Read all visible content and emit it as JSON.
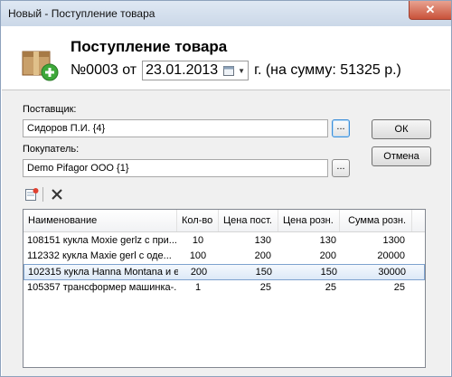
{
  "window": {
    "title": "Новый - Поступление товара"
  },
  "header": {
    "title": "Поступление товара",
    "number_label": "№0003 от",
    "date": "23.01.2013",
    "sum_text": "г. (на сумму: 51325 р.)"
  },
  "form": {
    "supplier_label": "Поставщик:",
    "supplier_value": "Сидоров П.И. {4}",
    "buyer_label": "Покупатель:",
    "buyer_value": "Demo Pifagor ООО {1}",
    "ellipsis": "...",
    "ok_label": "ОК",
    "cancel_label": "Отмена"
  },
  "toolbar": {
    "add_icon": "add-row-icon",
    "delete_icon": "delete-icon"
  },
  "table": {
    "columns": [
      "Наименование",
      "Кол-во",
      "Цена пост.",
      "Цена розн.",
      "Сумма розн."
    ],
    "rows": [
      {
        "name": "108151 кукла Moxie gerlz с при...",
        "qty": "10",
        "price_in": "130",
        "price_retail": "130",
        "sum_retail": "1300"
      },
      {
        "name": "112332 кукла Maxie gerl  с оде...",
        "qty": "100",
        "price_in": "200",
        "price_retail": "200",
        "sum_retail": "20000"
      },
      {
        "name": "102315 кукла Hanna Montana и ее г",
        "qty": "200",
        "price_in": "150",
        "price_retail": "150",
        "sum_retail": "30000"
      },
      {
        "name": "105357 трансформер машинка-...",
        "qty": "1",
        "price_in": "25",
        "price_retail": "25",
        "sum_retail": "25"
      }
    ],
    "selected_row": 2
  }
}
